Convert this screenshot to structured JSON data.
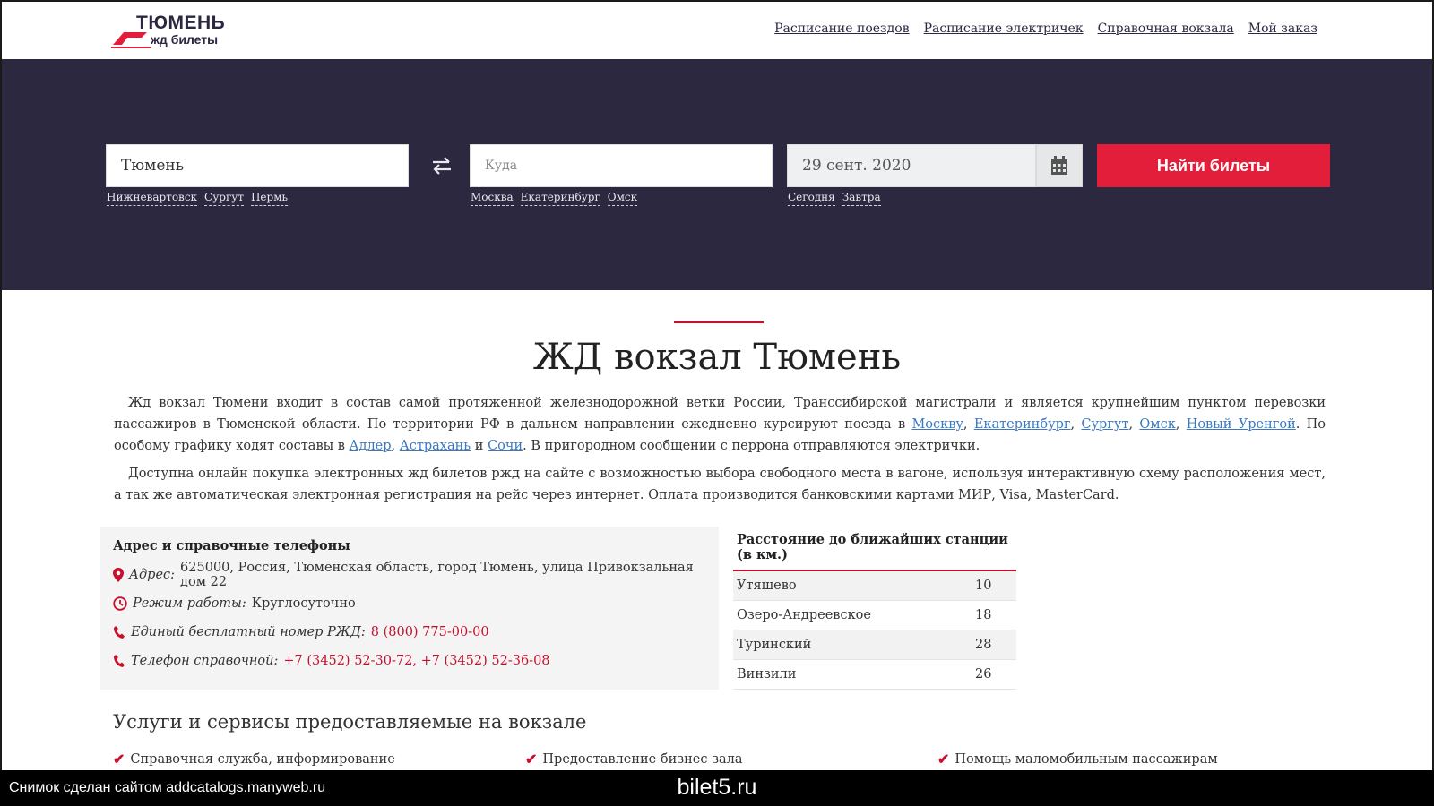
{
  "header": {
    "logo_title": "ТЮМЕНЬ",
    "logo_sub": "жд билеты",
    "nav": [
      "Расписание поездов",
      "Расписание электричек",
      "Справочная вокзала",
      "Мой заказ"
    ]
  },
  "search": {
    "from_value": "Тюмень",
    "to_placeholder": "Куда",
    "date_value": "29 сент. 2020",
    "find_label": "Найти билеты",
    "from_quick": [
      "Нижневартовск",
      "Сургут",
      "Пермь"
    ],
    "to_quick": [
      "Москва",
      "Екатеринбург",
      "Омск"
    ],
    "date_quick": [
      "Сегодня",
      "Завтра"
    ]
  },
  "main": {
    "title": "ЖД вокзал Тюмень",
    "p1_text1": "Жд вокзал Тюмени входит в состав самой протяженной железнодорожной ветки России, Транссибирской магистрали и является крупнейшим пунктом перевозки пассажиров в Тюменской области. По территории РФ в дальнем направлении ежедневно курсируют поезда в ",
    "p1_links1": [
      "Москву",
      "Екатеринбург",
      "Сургут",
      "Омск",
      "Новый Уренгой"
    ],
    "p1_text2": ". По особому графику ходят составы в ",
    "p1_links2": [
      "Адлер",
      "Астрахань"
    ],
    "p1_and": " и ",
    "p1_link3": "Сочи",
    "p1_text3": ". В пригородном сообщении с перрона отправляются электрички.",
    "p2": "Доступна онлайн покупка электронных жд билетов ржд на сайте с возможностью выбора свободного места в вагоне, используя интерактивную схему расположения мест, а так же автоматическая электронная регистрация на рейс через интернет. Оплата производится банковскими картами МИР, Visa, MasterCard."
  },
  "address": {
    "title": "Адрес и справочные телефоны",
    "addr_label": "Адрес:",
    "addr_value": "625000, Россия, Тюменская область, город Тюмень, улица Привокзальная дом 22",
    "hours_label": "Режим работы:",
    "hours_value": "Круглосуточно",
    "free_label": "Единый бесплатный номер РЖД:",
    "free_value": "8 (800) 775-00-00",
    "phone_label": "Телефон справочной:",
    "phone_value": "+7 (3452) 52-30-72, +7 (3452) 52-36-08"
  },
  "distances": {
    "title": "Расстояние до ближайших станции (в км.)",
    "rows": [
      {
        "name": "Утяшево",
        "km": "10"
      },
      {
        "name": "Озеро-Андреевское",
        "km": "18"
      },
      {
        "name": "Туринский",
        "km": "28"
      },
      {
        "name": "Винзили",
        "km": "26"
      }
    ]
  },
  "services": {
    "title": "Услуги и сервисы предоставляемые на вокзале",
    "items": [
      "Справочная служба, информирование",
      "Предоставление бизнес зала",
      "Помощь маломобильным пассажирам"
    ]
  },
  "watermark": {
    "left": "Снимок сделан сайтом addcatalogs.manyweb.ru",
    "center": "bilet5.ru"
  },
  "colors": {
    "hero_bg": "#2b2840",
    "accent_red": "#e31e3a",
    "link_blue": "#3a78c2"
  }
}
